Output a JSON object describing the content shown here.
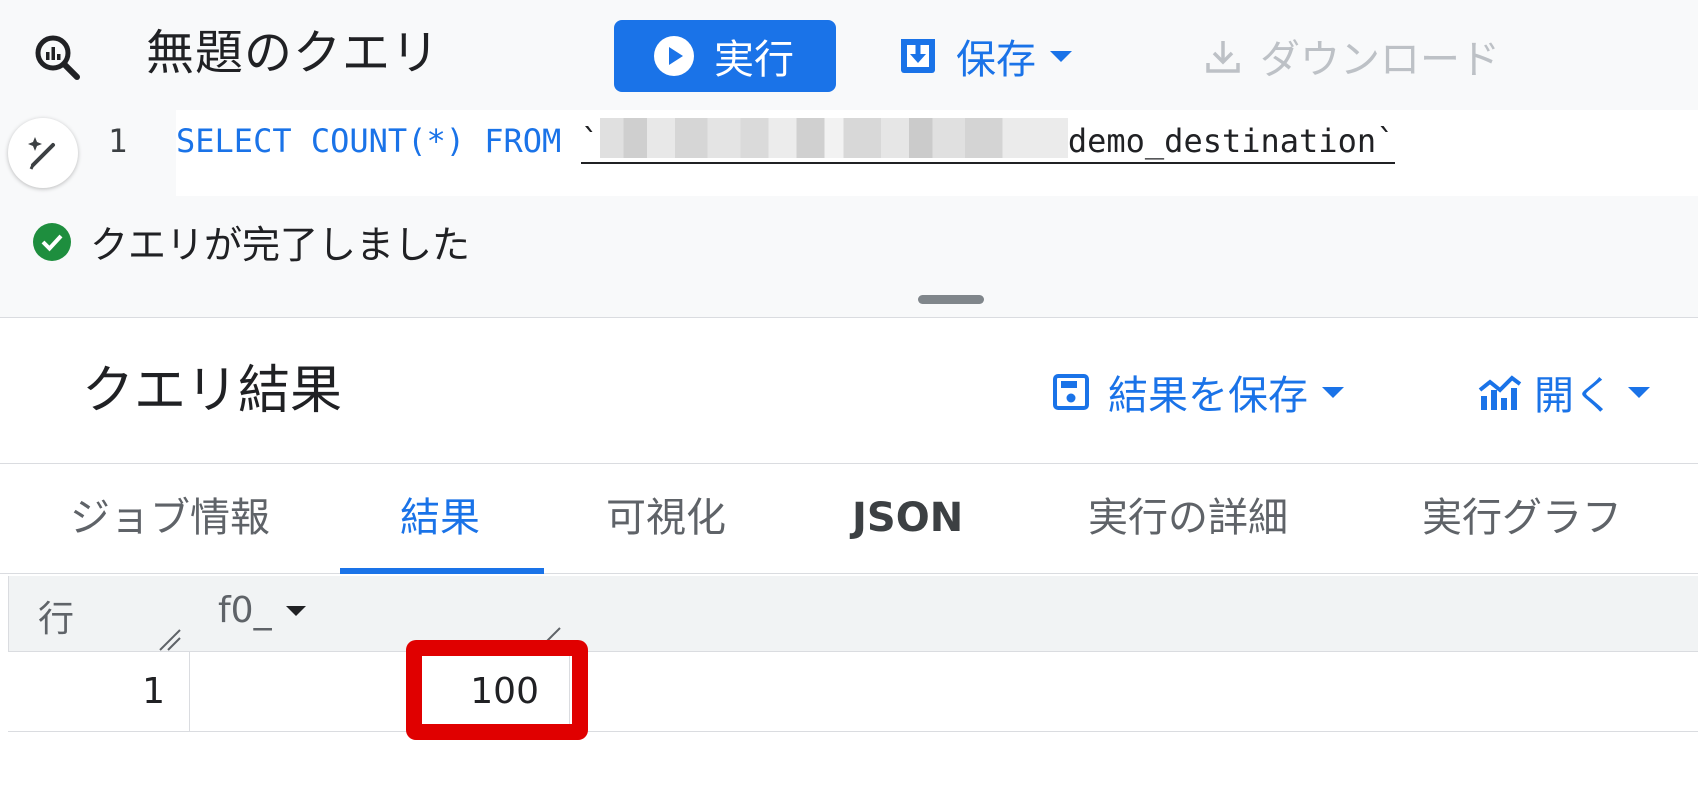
{
  "toolbar": {
    "query_title": "無題のクエリ",
    "run_label": "実行",
    "save_label": "保存",
    "download_label": "ダウンロード"
  },
  "editor": {
    "line_number": "1",
    "code": {
      "select_kw": "SELECT",
      "count_expr": "COUNT(*)",
      "from_kw": "FROM",
      "backtick_open": "`",
      "table_suffix": "demo_destination`"
    }
  },
  "status": {
    "message": "クエリが完了しました"
  },
  "results": {
    "title": "クエリ結果",
    "save_results_label": "結果を保存",
    "open_label": "開く",
    "tabs": [
      {
        "label": "ジョブ情報"
      },
      {
        "label": "結果"
      },
      {
        "label": "可視化"
      },
      {
        "label": "JSON"
      },
      {
        "label": "実行の詳細"
      },
      {
        "label": "実行グラフ"
      }
    ],
    "active_tab": "結果",
    "columns": {
      "row_header": "行",
      "f0_header": "f0_"
    },
    "rows": [
      {
        "row": "1",
        "f0_": "100"
      }
    ]
  },
  "colors": {
    "accent": "#1a73e8",
    "success": "#1e8e3e",
    "highlight": "#e00000",
    "disabled": "#bdc1c6"
  }
}
